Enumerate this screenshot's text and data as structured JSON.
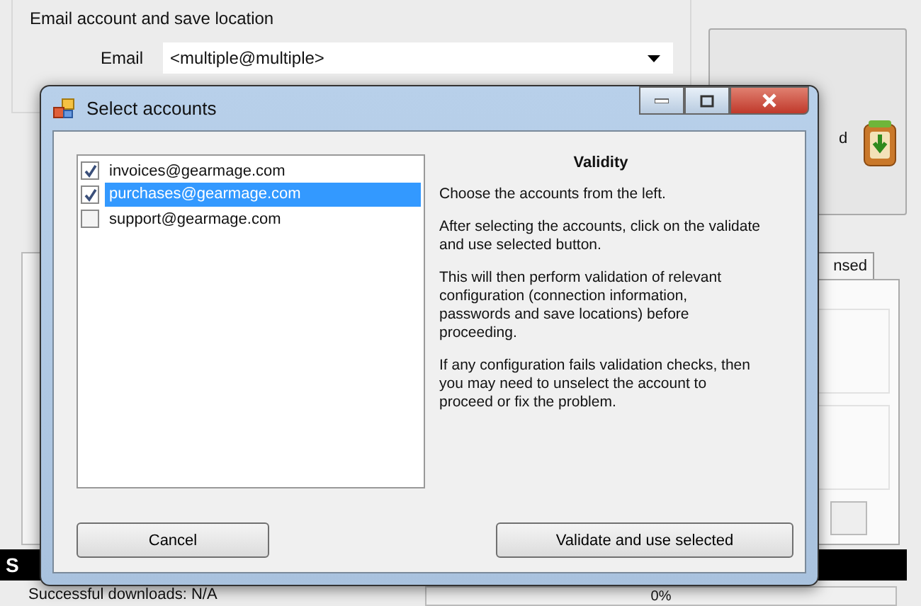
{
  "background": {
    "group_title": "Email account and save location",
    "email_label": "Email",
    "email_value": "<multiple@multiple>",
    "side_text": "d",
    "tab_label": "nsed",
    "status_text": "S",
    "downloads_label": "Successful downloads: N/A",
    "progress_text": "0%"
  },
  "dialog": {
    "title": "Select accounts",
    "accounts": [
      {
        "label": "invoices@gearmage.com",
        "checked": true,
        "selected": false
      },
      {
        "label": "purchases@gearmage.com",
        "checked": true,
        "selected": true
      },
      {
        "label": "support@gearmage.com",
        "checked": false,
        "selected": false
      }
    ],
    "heading": "Validity",
    "paragraphs": [
      "Choose the accounts from the left.",
      "After selecting the accounts, click on the validate and use selected button.",
      "This will then perform validation of relevant configuration (connection information, passwords and save locations) before proceeding.",
      "If any configuration fails validation checks, then you may need to unselect the account to proceed or fix the problem."
    ],
    "buttons": [
      "Cancel",
      "Validate and use selected"
    ]
  }
}
